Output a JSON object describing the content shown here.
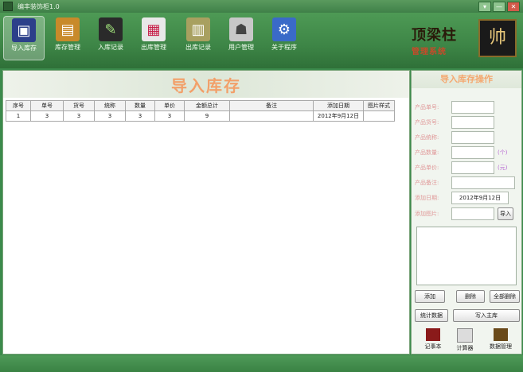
{
  "window": {
    "title": "编丰装饰柜1.0",
    "controls": [
      "▾",
      "—",
      "✕"
    ]
  },
  "toolbar": [
    {
      "label": "导入库存",
      "icon": "suitcase-icon",
      "active": true
    },
    {
      "label": "库存管理",
      "icon": "wallet-icon",
      "active": false
    },
    {
      "label": "入库记录",
      "icon": "notebook-icon",
      "active": false
    },
    {
      "label": "出库管理",
      "icon": "cards-icon",
      "active": false
    },
    {
      "label": "出库记录",
      "icon": "folder-icon",
      "active": false
    },
    {
      "label": "用户管理",
      "icon": "users-icon",
      "active": false
    },
    {
      "label": "关于程序",
      "icon": "network-icon",
      "active": false
    }
  ],
  "brand": {
    "name": "顶梁柱",
    "subtitle": "管理系统",
    "logo_char": "帅"
  },
  "main": {
    "title": "导入库存",
    "columns": [
      "序号",
      "单号",
      "货号",
      "统称",
      "数量",
      "单价",
      "金额总计",
      "备注",
      "添加日期",
      "图片样式"
    ],
    "rows": [
      [
        "1",
        "3",
        "3",
        "3",
        "3",
        "3",
        "9",
        "",
        "2012年9月12日",
        ""
      ]
    ]
  },
  "side": {
    "title": "导入库存操作",
    "fields": [
      {
        "label": "产品单号:",
        "value": "",
        "unit": ""
      },
      {
        "label": "产品货号:",
        "value": "",
        "unit": ""
      },
      {
        "label": "产品统称:",
        "value": "",
        "unit": ""
      },
      {
        "label": "产品数量:",
        "value": "",
        "unit": "(个)"
      },
      {
        "label": "产品单价:",
        "value": "",
        "unit": "(元)"
      },
      {
        "label": "产品备注:",
        "value": "",
        "unit": ""
      },
      {
        "label": "添加日期:",
        "value": "2012年9月12日",
        "unit": ""
      },
      {
        "label": "添加图片:",
        "value": "",
        "unit": ""
      }
    ],
    "import_button": "导入",
    "buttons": {
      "add": "添加",
      "delete": "删除",
      "delete_all": "全部删除",
      "stats": "统计数据",
      "write_main": "写入主库"
    },
    "shortcuts": [
      {
        "label": "记事本",
        "icon": "notebook-icon"
      },
      {
        "label": "计算器",
        "icon": "calculator-icon"
      },
      {
        "label": "数据管理",
        "icon": "database-icon"
      }
    ]
  },
  "colors": {
    "frame_green": "#3c8a4c",
    "title_orange": "#f2a06a",
    "label_pink": "#e09898",
    "unit_purple": "#b86ad2"
  }
}
